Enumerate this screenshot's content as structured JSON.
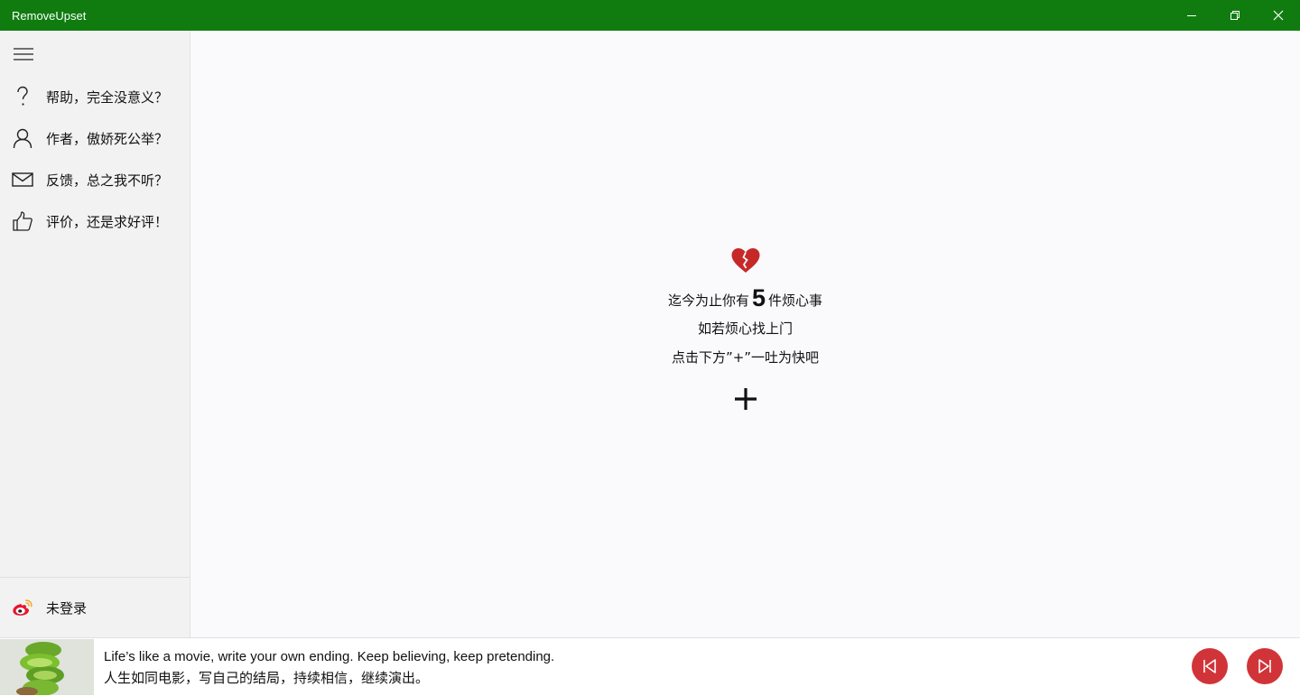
{
  "window": {
    "title": "RemoveUpset",
    "minimize_icon": "minimize-icon",
    "restore_icon": "restore-icon",
    "close_icon": "close-icon",
    "accent": "#107c10"
  },
  "sidebar": {
    "menu_icon": "hamburger-icon",
    "items": [
      {
        "label": "帮助，完全没意义？",
        "icon": "question-icon"
      },
      {
        "label": "作者，傲娇死公举？",
        "icon": "person-icon"
      },
      {
        "label": "反馈，总之我不听？",
        "icon": "mail-icon"
      },
      {
        "label": "评价，还是求好评！",
        "icon": "thumbs-up-icon"
      }
    ],
    "login": {
      "label": "未登录",
      "icon": "weibo-icon"
    }
  },
  "main": {
    "icon": "broken-heart-icon",
    "count_prefix": "迄今为止你有",
    "count": "5",
    "count_suffix": "件烦心事",
    "line2": "如若烦心找上门",
    "line3": "点击下方”+”一吐为快吧",
    "add_icon": "plus-icon",
    "heart_color": "#c62828"
  },
  "bottom": {
    "quote_en": "Life’s like a movie, write your own ending. Keep believing, keep pretending.",
    "quote_zh": "人生如同电影，写自己的结局，持续相信，继续演出。",
    "prev_icon": "skip-previous-icon",
    "next_icon": "skip-next-icon",
    "button_color": "#d13438"
  }
}
